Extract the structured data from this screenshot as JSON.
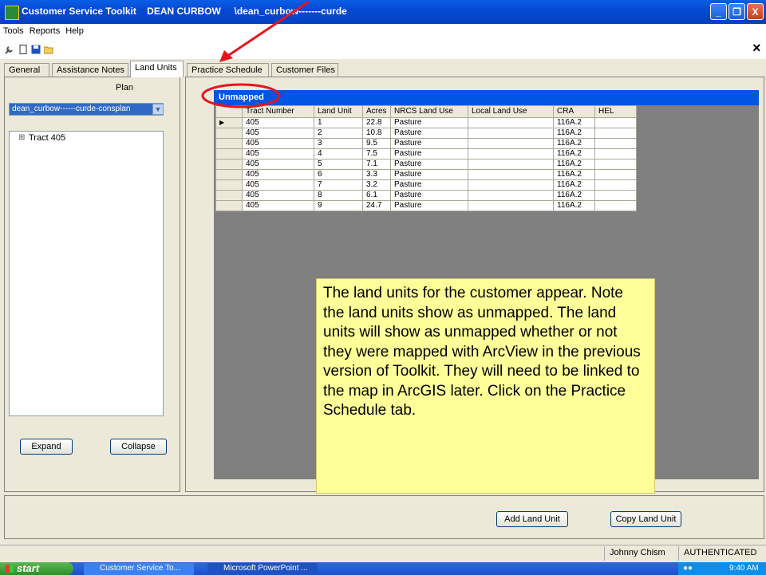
{
  "window": {
    "title": "Customer Service Toolkit    DEAN CURBOW     \\dean_curbow-------curde",
    "controls": {
      "minimize": "_",
      "restore": "❐",
      "close": "X"
    }
  },
  "menu": [
    "Tools",
    "Reports",
    "Help"
  ],
  "toolbar": {
    "close_glyph": "×"
  },
  "tabs": [
    "General",
    "Assistance Notes",
    "Land Units",
    "Practice Schedule",
    "Customer Files"
  ],
  "left": {
    "plan_label": "Plan",
    "plan_select": "dean_curbow------curde-consplan",
    "tree_item": "Tract 405",
    "tree_toggle": "⊞",
    "expand_label": "Expand",
    "collapse_label": "Collapse"
  },
  "grid": {
    "header": "Unmapped",
    "columns": [
      "Tract Number",
      "Land Unit",
      "Acres",
      "NRCS Land Use",
      "Local Land Use",
      "CRA",
      "HEL"
    ],
    "rows": [
      [
        "405",
        "1",
        "22.8",
        "Pasture",
        "",
        "116A.2",
        ""
      ],
      [
        "405",
        "2",
        "10.8",
        "Pasture",
        "",
        "116A.2",
        ""
      ],
      [
        "405",
        "3",
        "9.5",
        "Pasture",
        "",
        "116A.2",
        ""
      ],
      [
        "405",
        "4",
        "7.5",
        "Pasture",
        "",
        "116A.2",
        ""
      ],
      [
        "405",
        "5",
        "7.1",
        "Pasture",
        "",
        "116A.2",
        ""
      ],
      [
        "405",
        "6",
        "3.3",
        "Pasture",
        "",
        "116A.2",
        ""
      ],
      [
        "405",
        "7",
        "3.2",
        "Pasture",
        "",
        "116A.2",
        ""
      ],
      [
        "405",
        "8",
        "6.1",
        "Pasture",
        "",
        "116A.2",
        ""
      ],
      [
        "405",
        "9",
        "24.7",
        "Pasture",
        "",
        "116A.2",
        ""
      ]
    ]
  },
  "callout": "The land units for the customer appear. Note the land units show as unmapped. The land units will show as unmapped whether or not they were mapped with ArcView in the previous version of Toolkit. They will need to be linked to the map in ArcGIS later. Click on the Practice Schedule tab.",
  "bottom": {
    "add_label": "Add Land Unit",
    "copy_label": "Copy Land Unit"
  },
  "status": {
    "user": "Johnny Chism",
    "auth": "AUTHENTICATED"
  },
  "taskbar": {
    "start": "start",
    "tasks": [
      "Customer Service To...",
      "Microsoft PowerPoint ..."
    ],
    "clock": "9:40 AM"
  },
  "annotation_color": "#e8141c"
}
